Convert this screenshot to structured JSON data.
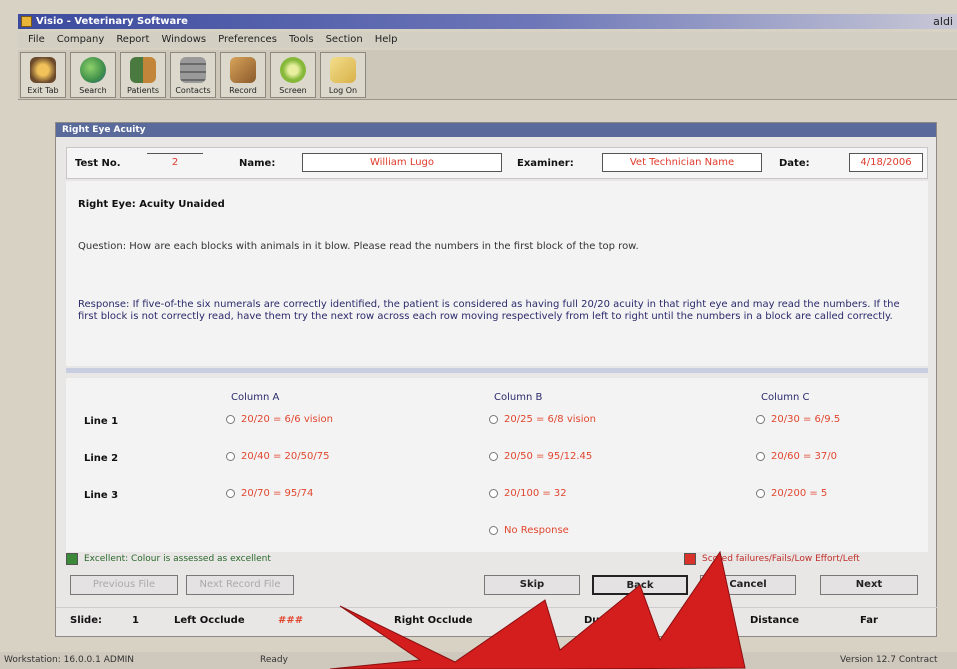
{
  "window": {
    "title": "Visio - Veterinary Software",
    "corner_text": "aldi"
  },
  "menu": [
    "File",
    "Company",
    "Report",
    "Windows",
    "Preferences",
    "Tools",
    "Section",
    "Help"
  ],
  "toolbar": [
    {
      "label": "Exit Tab",
      "icon": "exit-icon",
      "color": "#6b4a2b"
    },
    {
      "label": "Search",
      "icon": "globe-icon",
      "color": "#3f8f4a"
    },
    {
      "label": "Patients",
      "icon": "people-icon",
      "color": "#4a7a3f"
    },
    {
      "label": "Contacts",
      "icon": "cabinet-icon",
      "color": "#8a8a8a"
    },
    {
      "label": "Record",
      "icon": "box-icon",
      "color": "#b07a3a"
    },
    {
      "label": "Screen",
      "icon": "gear-icon",
      "color": "#86b83a"
    },
    {
      "label": "Log On",
      "icon": "key-icon",
      "color": "#d8b24a"
    }
  ],
  "dialog": {
    "title": "Right Eye Acuity",
    "test_no_label": "Test No.",
    "test_no": "2",
    "name_label": "Name:",
    "name": "William Lugo",
    "examiner_label": "Examiner:",
    "examiner": "Vet Technician Name",
    "date_label": "Date:",
    "date": "4/18/2006",
    "row_title": "Right Eye: Acuity Unaided",
    "question": "Question: How are each blocks with animals in it blow. Please read the numbers in the first block of the top row.",
    "response": "Response: If five-of-the six numerals are correctly identified, the patient is considered as having full 20/20 acuity in that right eye and may read the numbers. If the first block is not correctly read, have them try the next row across each row moving respectively from left to right until the numbers in a block are called correctly.",
    "columns": [
      "Column A",
      "Column B",
      "Column C"
    ],
    "lines": [
      {
        "label": "Line 1",
        "options": [
          "20/20 = 6/6 vision",
          "20/25 = 6/8 vision",
          "20/30 = 6/9.5"
        ]
      },
      {
        "label": "Line 2",
        "options": [
          "20/40 = 20/50/75",
          "20/50 = 95/12.45",
          "20/60 = 37/0"
        ]
      },
      {
        "label": "Line 3",
        "options": [
          "20/70 = 95/74",
          "20/100 = 32",
          "20/200 = 5"
        ]
      }
    ],
    "no_response": "No Response",
    "legend_good": "Excellent: Colour is assessed as excellent",
    "legend_bad": "Scored failures/Fails/Low Effort/Left",
    "buttons": {
      "prev": "Previous File",
      "next_record": "Next Record File",
      "skip": "Skip",
      "back": "Back",
      "cancel": "Cancel",
      "next": "Next"
    },
    "status": {
      "slide_label": "Slide:",
      "slide_value": "1",
      "left_label": "Left Occlude",
      "left_value": "###",
      "right_label": "Right Occlude",
      "duration_label": "Duration",
      "distance_label": "Distance",
      "distance_value": "Far"
    }
  },
  "statusbar": {
    "left": "Workstation: 16.0.0.1  ADMIN",
    "mid": "Ready",
    "right": "Version 12.7 Contract"
  },
  "colors": {
    "accent_red": "#e0472f",
    "legend_green": "#3a8a3a",
    "legend_red": "#d9322a",
    "burst_red": "#d41d1d"
  }
}
